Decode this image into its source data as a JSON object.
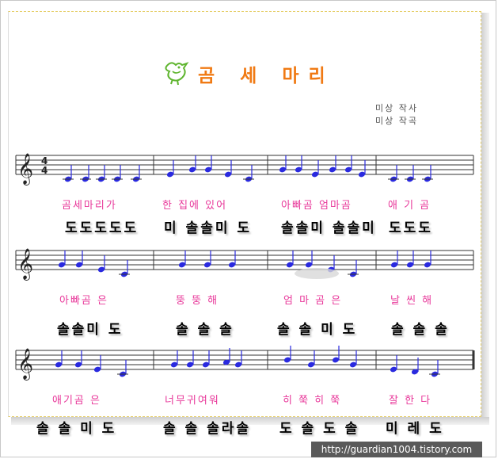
{
  "title": "곰 세 마리",
  "credits": [
    "미상  작사",
    "미상  작곡"
  ],
  "time_signature": {
    "top": "4",
    "bottom": "4"
  },
  "lines": [
    {
      "lyrics": [
        "곰세마리가",
        "한 집에 있어",
        "아빠곰 엄마곰",
        "애 기 곰"
      ],
      "solfege": [
        "도도도도도",
        "미 솔솔미 도",
        "솔솔미 솔솔미",
        "도도도"
      ]
    },
    {
      "lyrics": [
        "아빠곰 은",
        "뚱 뚱 해",
        "엄 마 곰 은",
        "날 씬 해"
      ],
      "solfege": [
        "솔솔미 도",
        "솔 솔 솔",
        "솔 솔 미 도",
        "솔 솔 솔"
      ]
    },
    {
      "lyrics": [
        "애기곰 은",
        "너무귀여워",
        "히 쭉 히 쭉",
        "잘 한 다"
      ],
      "solfege": [
        "솔 솔 미 도",
        "솔 솔 솔라솔",
        "도 솔 도 솔",
        "미 레 도"
      ]
    }
  ],
  "watermark": "http://guardian1004.tistory.com",
  "colors": {
    "title": "#f07a14",
    "lyrics": "#e8389a",
    "notes": "#2a2adf",
    "bird": "#5fb52f"
  }
}
